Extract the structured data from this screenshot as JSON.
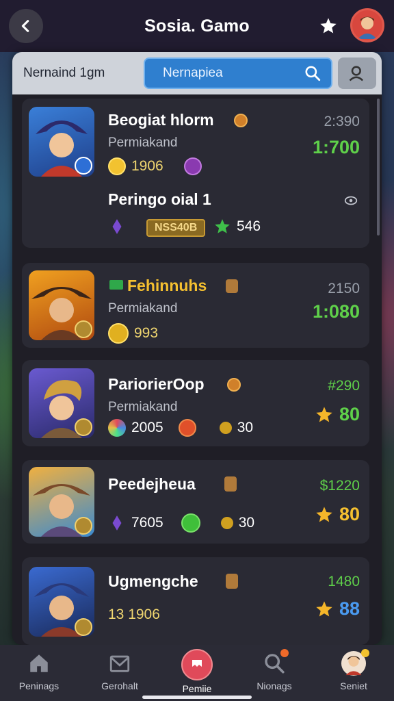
{
  "header": {
    "title": "Sosia. Gamo"
  },
  "search": {
    "label": "Nernaind 1gm",
    "value": "Nernapiea"
  },
  "cards": [
    {
      "name": "Beogiat hlorm",
      "sub": "Permiakand",
      "rank": "2:390",
      "score": "1:700",
      "stat1": "1906",
      "extra_title": "Peringo oial 1",
      "tag": "NSS40B",
      "stat2": "546"
    },
    {
      "name": "Fehinnuhs",
      "sub": "Permiakand",
      "rank": "2150",
      "score": "1:080",
      "stat1": "993"
    },
    {
      "name": "PariorierOop",
      "sub": "Permiakand",
      "rank": "#290",
      "score": "80",
      "stat1": "2005",
      "stat2": "30"
    },
    {
      "name": "Peedejheua",
      "rank": "$1220",
      "score": "80",
      "stat1": "7605",
      "stat2": "30"
    },
    {
      "name": "Ugmengche",
      "rank": "1480",
      "score": "88",
      "stat1": "13 1906"
    }
  ],
  "nav": [
    {
      "label": "Peninags",
      "icon": "home-icon"
    },
    {
      "label": "Gerohalt",
      "icon": "mail-icon"
    },
    {
      "label": "Pemiie",
      "icon": "bookmark-icon"
    },
    {
      "label": "Nionags",
      "icon": "search-icon"
    },
    {
      "label": "Seniet",
      "icon": "avatar-icon"
    }
  ],
  "colors": {
    "score_green": "#5fd04a",
    "star_gold": "#f5b62a",
    "accent_blue": "#2f7fcf",
    "active_red": "#e04a5a"
  }
}
